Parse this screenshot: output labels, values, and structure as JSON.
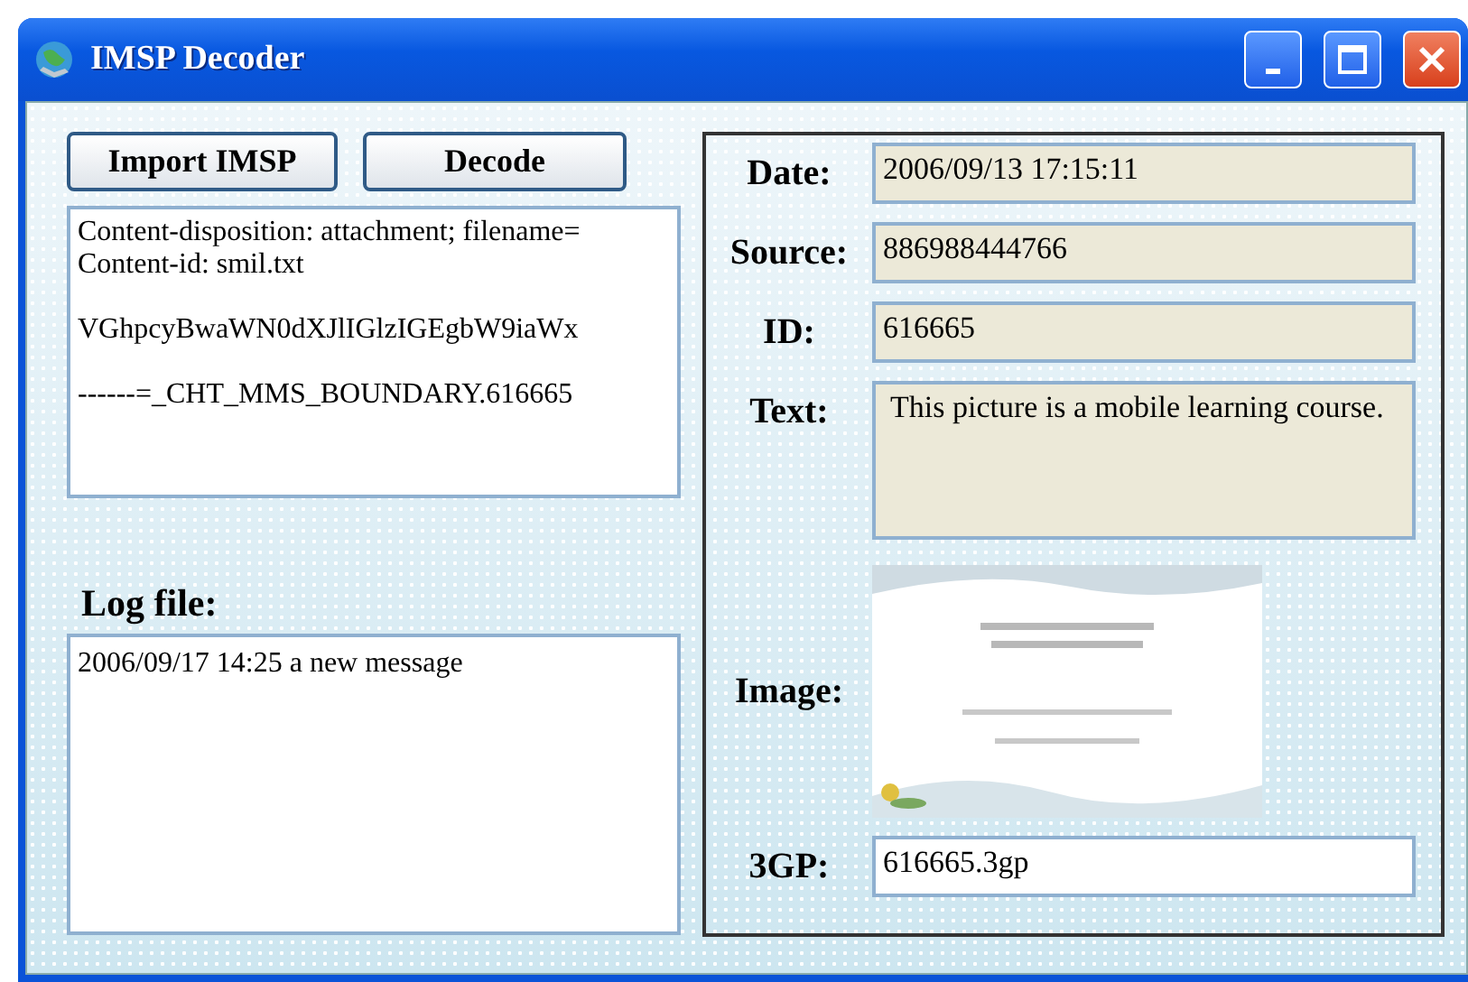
{
  "window": {
    "title": "IMSP Decoder"
  },
  "buttons": [
    {
      "label": "Import IMSP"
    },
    {
      "label": "Decode"
    }
  ],
  "content_box": {
    "paragraphs": [
      [
        "Content-disposition: attachment; filename=",
        "Content-id: smil.txt"
      ],
      [
        "VGhpcyBwaWN0dXJlIGlzIGEgbW9iaWx"
      ],
      [
        "------=_CHT_MMS_BOUNDARY.616665"
      ]
    ]
  },
  "log": {
    "label": "Log file:",
    "value": "2006/09/17 14:25 a new message"
  },
  "details": [
    {
      "kind": "field",
      "label": "Date:",
      "value": "2006/09/13 17:15:11",
      "readonly": true
    },
    {
      "kind": "field",
      "label": "Source:",
      "value": "886988444766",
      "readonly": true
    },
    {
      "kind": "field",
      "label": "ID:",
      "value": "616665",
      "readonly": true
    },
    {
      "kind": "memo",
      "label": "Text:",
      "value": "This picture is a mobile learning course.",
      "readonly": true
    },
    {
      "kind": "picture",
      "label": "Image:"
    },
    {
      "kind": "field",
      "label": "3GP:",
      "value": "616665.3gp",
      "readonly": false
    }
  ]
}
